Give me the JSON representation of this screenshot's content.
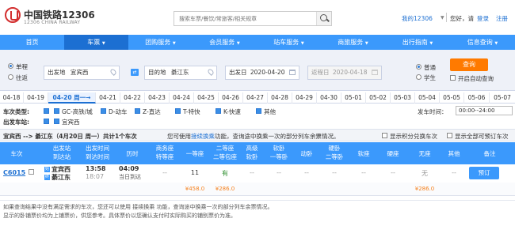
{
  "header": {
    "logo_cn": "中国铁路12306",
    "logo_en": "12306 CHINA RAILWAY",
    "search_placeholder": "搜索车票/餐饮/常旅客/相关规章",
    "my_link": "我的12306",
    "greeting": "您好，请",
    "login": "登录",
    "register": "注册"
  },
  "nav": [
    "首页",
    "车票",
    "团购服务",
    "会员服务",
    "站车服务",
    "商旅服务",
    "出行指南",
    "信息查询"
  ],
  "nav_active": "车票",
  "search_form": {
    "trip_one_way": "单程",
    "trip_round": "往返",
    "from_label": "出发地",
    "from_value": "宜宾西",
    "to_label": "目的地",
    "to_value": "綦江东",
    "depart_label": "出发日",
    "depart_value": "2020-04-20",
    "return_label": "返程日",
    "return_value": "2020-04-18",
    "type_normal": "普通",
    "type_student": "学生",
    "query_button": "查询",
    "auto_query": "开启自动查询"
  },
  "dates": [
    "04-18",
    "04-19",
    "04-20 周一",
    "04-21",
    "04-22",
    "04-23",
    "04-24",
    "04-25",
    "04-26",
    "04-27",
    "04-28",
    "04-29",
    "04-30",
    "05-01",
    "05-02",
    "05-03",
    "05-04",
    "05-05",
    "05-06",
    "05-07"
  ],
  "active_date": "04-20 周一",
  "filters": {
    "train_type_label": "车次类型:",
    "train_types": [
      "GC-高铁/城",
      "D-动车",
      "Z-直达",
      "T-特快",
      "K-快速",
      "其他"
    ],
    "depart_station_label": "出发车站:",
    "depart_station": "宜宾西",
    "depart_time_label": "发车时间：",
    "depart_time_value": "00:00--24:00"
  },
  "summary": {
    "route": "宜宾西 --> 綦江东（4月20日 周一）共计1个车次",
    "tip_pre": "您可使用",
    "tip_link": "接续换乘",
    "tip_post": "功能，查询途中换乘一次的部分列车余票情况。",
    "show_points": "显示积分兑换车次",
    "show_all": "显示全部可预订车次"
  },
  "table": {
    "headers": [
      "车次",
      "出发站\n到达站",
      "出发时间\n到达时间",
      "历时",
      "商务座\n特等座",
      "一等座",
      "二等座\n二等包座",
      "高级\n软卧",
      "软卧\n一等卧",
      "动卧",
      "硬卧\n二等卧",
      "软座",
      "硬座",
      "无座",
      "其他",
      "备注"
    ],
    "rows": [
      {
        "train": "C6015",
        "from_station": "宜宾西",
        "to_station": "綦江东",
        "depart": "13:58",
        "arrive": "18:07",
        "duration": "04:09",
        "duration_note": "当日到达",
        "business": "--",
        "first": "11",
        "second": "有",
        "premium_soft": "--",
        "soft_sleeper": "--",
        "moving_sleeper": "--",
        "hard_sleeper": "--",
        "soft_seat": "--",
        "hard_seat": "--",
        "no_seat": "无",
        "other": "--",
        "book": "预订",
        "price_first": "¥458.0",
        "price_second": "¥286.0",
        "price_no_seat": "¥286.0"
      }
    ]
  },
  "notice": [
    "如果查询结果中没有满足需求的车次，您还可以使用 接续换乘 功能，查询途中换乘一次的部分列车余票情况。",
    "显示的卧铺票价均为上铺票价，供您参考。具体票价以您确认支付时实际购买的铺别票价为准。"
  ],
  "colors": {
    "primary": "#3b99fc",
    "active_nav": "#1c6fd2",
    "price": "#f58220",
    "query_btn": "#ff7a00",
    "seat_yes": "#2f8f2f"
  }
}
